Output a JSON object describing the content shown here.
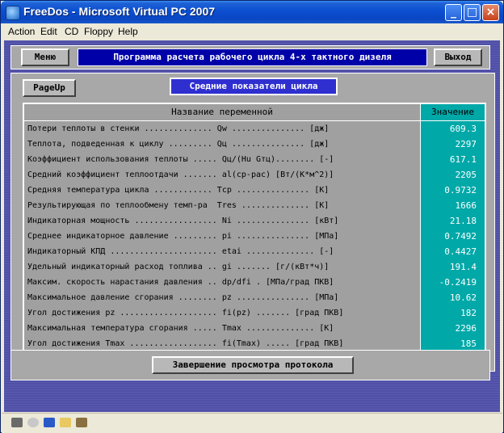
{
  "window": {
    "title": "FreeDos - Microsoft Virtual PC 2007",
    "minimize": "_",
    "maximize": "□",
    "close": "×"
  },
  "menu": [
    "Action",
    "Edit",
    "CD",
    "Floppy",
    "Help"
  ],
  "dos": {
    "menu_button": "Меню",
    "banner": "Программа расчета рабочего цикла 4-х тактного дизеля",
    "exit_button": "Выход",
    "pageup_button": "PageUp",
    "panel_title": "Средние показатели цикла",
    "table": {
      "header_name": "Название переменной",
      "header_value": "Значение",
      "rows": [
        {
          "name": "Потери теплоты в стенки .............. Qw ............... [дж]",
          "value": "609.3"
        },
        {
          "name": "Теплота, подведенная к циклу ......... Qц ............... [дж]",
          "value": "2297"
        },
        {
          "name": "Коэффициент использования теплоты ..... Qц/(Hu Gтц)........ [-]",
          "value": "617.1"
        },
        {
          "name": "Средний коэффициент теплоотдачи ....... al(ср-рас) [Вт/(К*м^2)]",
          "value": "2205"
        },
        {
          "name": "Средняя температура цикла ............ Tср ............... [K]",
          "value": "0.9732"
        },
        {
          "name": "Результирующая по теплообмену темп-ра  Tres .............. [K]",
          "value": "1666"
        },
        {
          "name": "Индикаторная мощность ................. Ni ............... [кВт]",
          "value": "21.18"
        },
        {
          "name": "Среднее индикаторное давление ......... pi ............... [МПа]",
          "value": "0.7492"
        },
        {
          "name": "Индикаторный КПД ...................... etai .............. [-]",
          "value": "0.4427"
        },
        {
          "name": "Удельный индикаторный расход топлива .. gi ....... [г/(кВт*ч)]",
          "value": "191.4"
        },
        {
          "name": "Максим. скорость нарастания давления .. dp/dfi . [МПа/град ПКВ]",
          "value": "-0.2419"
        },
        {
          "name": "Максимальное давление сгорания ........ pz ............... [МПа]",
          "value": "10.62"
        },
        {
          "name": "Угол достижения pz .................... fi(pz) ....... [град ПКВ]",
          "value": "182"
        },
        {
          "name": "Максимальная температура сгорания ..... Tmax .............. [K]",
          "value": "2296"
        },
        {
          "name": "Угол достижения Tmax .................. fi(Tmax) ..... [град ПКВ]",
          "value": "185"
        }
      ]
    },
    "finish_button": "Завершение просмотра протокола"
  },
  "colors": {
    "dos_background": "#5050a8",
    "panel": "#a8a8a8",
    "banner": "#0000a8",
    "value_column": "#00a8a8"
  }
}
